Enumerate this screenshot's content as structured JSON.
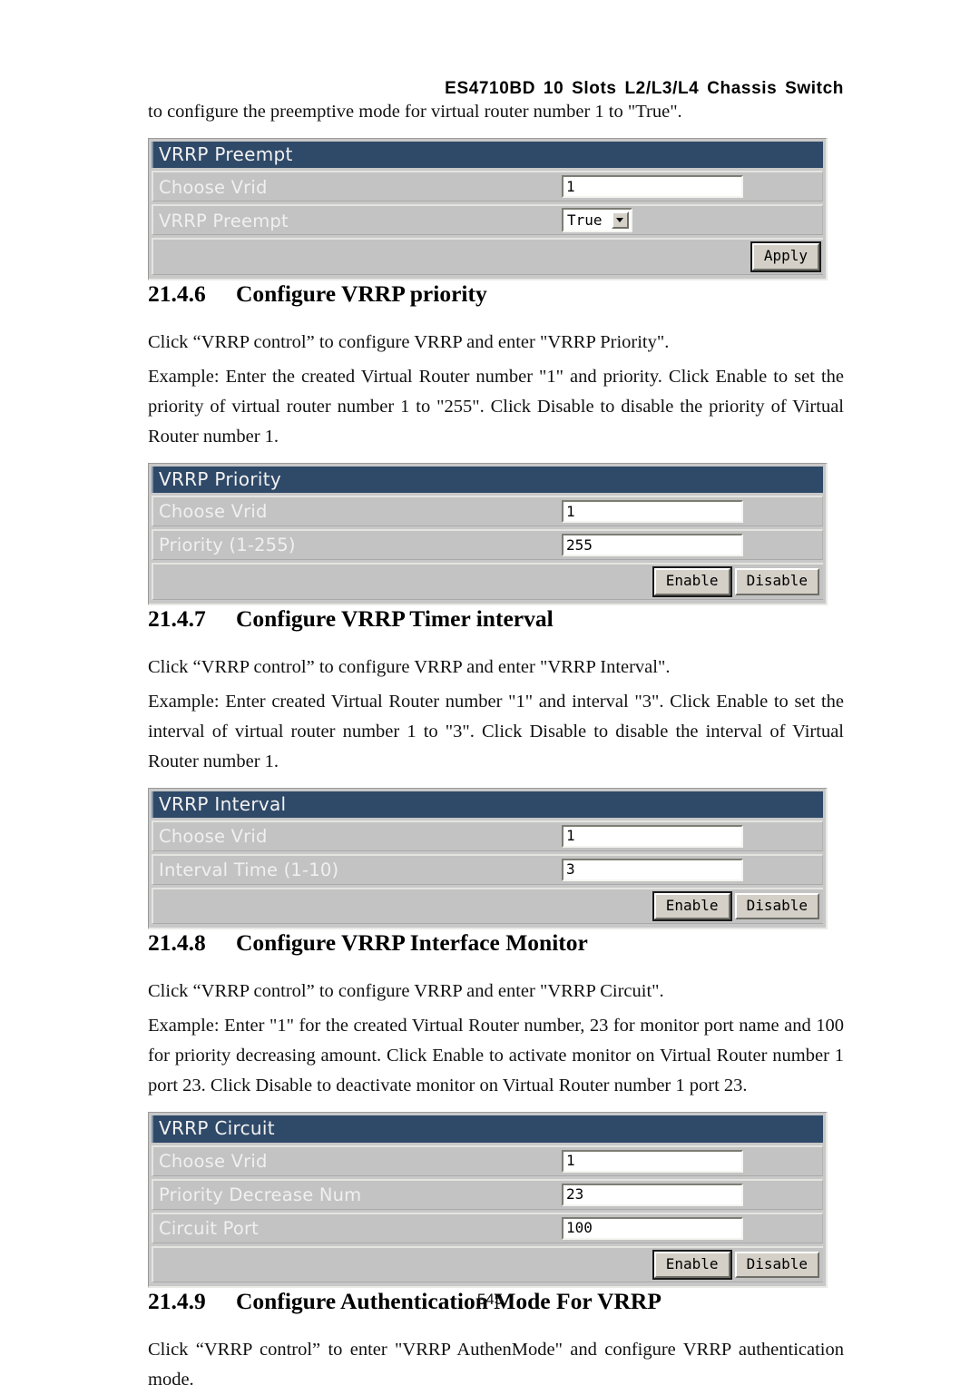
{
  "header": {
    "running_title": "ES4710BD 10 Slots L2/L3/L4 Chassis Switch"
  },
  "intro": {
    "continued_line": "to configure the preemptive mode for virtual router number 1 to \"True\"."
  },
  "panels": [
    {
      "title": "VRRP Preempt",
      "rows": [
        {
          "label": "Choose Vrid",
          "control": "text",
          "value": "1"
        },
        {
          "label": "VRRP Preempt",
          "control": "select",
          "value": "True"
        }
      ],
      "buttons": [
        {
          "label": "Apply",
          "focused": true
        }
      ]
    },
    {
      "title": "VRRP Priority",
      "rows": [
        {
          "label": "Choose Vrid",
          "control": "text",
          "value": "1"
        },
        {
          "label": "Priority (1-255)",
          "control": "text",
          "value": "255"
        }
      ],
      "buttons": [
        {
          "label": "Enable",
          "focused": true
        },
        {
          "label": "Disable",
          "focused": false
        }
      ]
    },
    {
      "title": "VRRP Interval",
      "rows": [
        {
          "label": "Choose Vrid",
          "control": "text",
          "value": "1"
        },
        {
          "label": "Interval Time (1-10)",
          "control": "text",
          "value": "3"
        }
      ],
      "buttons": [
        {
          "label": "Enable",
          "focused": true
        },
        {
          "label": "Disable",
          "focused": false
        }
      ]
    },
    {
      "title": "VRRP Circuit",
      "rows": [
        {
          "label": "Choose Vrid",
          "control": "text",
          "value": "1"
        },
        {
          "label": "Priority Decrease Num",
          "control": "text",
          "value": "23"
        },
        {
          "label": "Circuit Port",
          "control": "text",
          "value": "100"
        }
      ],
      "buttons": [
        {
          "label": "Enable",
          "focused": true
        },
        {
          "label": "Disable",
          "focused": false
        }
      ]
    }
  ],
  "sections": [
    {
      "number": "21.4.6",
      "title": "Configure VRRP priority",
      "paragraphs": [
        "Click “VRRP control” to configure VRRP and enter \"VRRP Priority\".",
        "Example: Enter the created Virtual Router number \"1\" and priority. Click Enable to set the priority of virtual router number 1 to \"255\". Click Disable to disable the priority of Virtual Router number 1."
      ]
    },
    {
      "number": "21.4.7",
      "title": "Configure VRRP Timer interval",
      "paragraphs": [
        "Click “VRRP control” to configure VRRP and enter \"VRRP Interval\".",
        "Example: Enter created Virtual Router number \"1\" and interval \"3\". Click Enable to set the interval of virtual router number 1 to \"3\". Click Disable to disable the interval of Virtual Router number 1."
      ]
    },
    {
      "number": "21.4.8",
      "title": "Configure VRRP Interface Monitor",
      "paragraphs": [
        "Click “VRRP control” to configure VRRP and enter \"VRRP Circuit\".",
        "Example: Enter \"1\" for the created Virtual Router number, 23 for monitor port name and 100 for priority decreasing amount. Click Enable to activate monitor on Virtual Router number 1 port 23. Click Disable to deactivate monitor on Virtual Router number 1 port 23."
      ]
    },
    {
      "number": "21.4.9",
      "title": "Configure Authentication Mode For VRRP",
      "paragraphs": [
        "Click “VRRP control” to enter \"VRRP AuthenMode\" and configure VRRP authentication mode."
      ]
    }
  ],
  "footer": {
    "page_number": "545"
  }
}
